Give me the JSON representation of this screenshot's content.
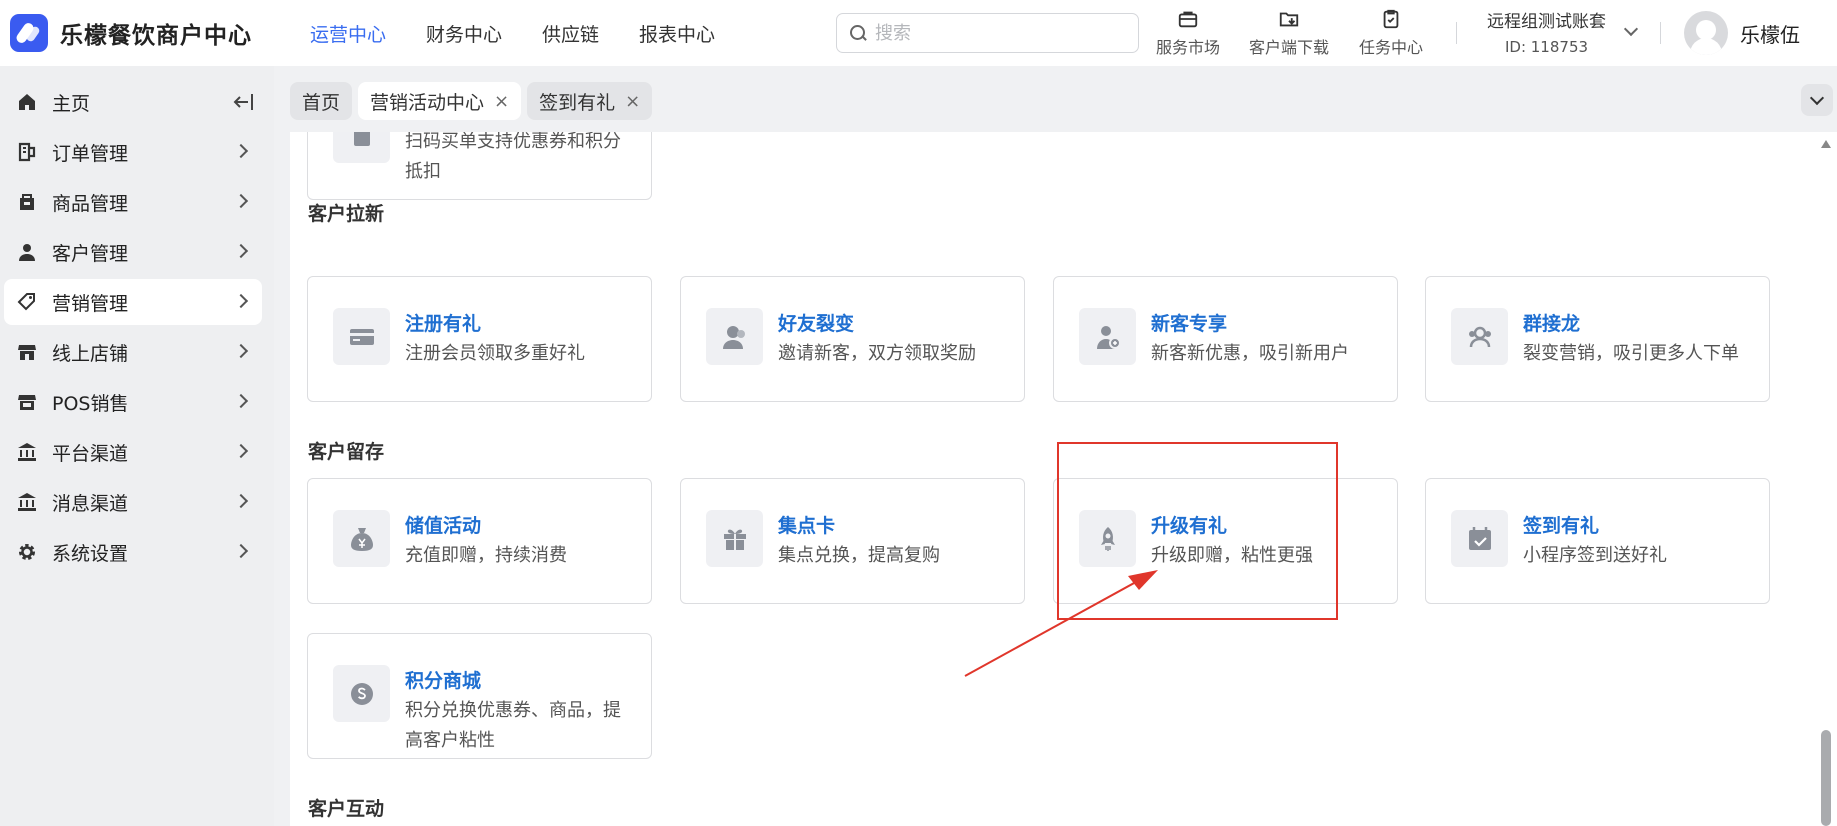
{
  "brand": {
    "name": "乐檬餐饮商户中心",
    "color": "#3a5bf0"
  },
  "topnav": [
    {
      "label": "运营中心",
      "active": true
    },
    {
      "label": "财务中心",
      "active": false
    },
    {
      "label": "供应链",
      "active": false
    },
    {
      "label": "报表中心",
      "active": false
    }
  ],
  "search": {
    "placeholder": "搜索",
    "value": ""
  },
  "tools": [
    {
      "label": "服务市场",
      "icon": "briefcase-icon"
    },
    {
      "label": "客户端下载",
      "icon": "folder-download-icon"
    },
    {
      "label": "任务中心",
      "icon": "clipboard-icon"
    }
  ],
  "account": {
    "name": "远程组测试账套",
    "id_text": "ID: 118753"
  },
  "user": {
    "name": "乐檬伍"
  },
  "sidebar": {
    "items": [
      {
        "label": "主页",
        "icon": "home-icon"
      },
      {
        "label": "订单管理",
        "icon": "order-icon"
      },
      {
        "label": "商品管理",
        "icon": "goods-icon"
      },
      {
        "label": "客户管理",
        "icon": "user-icon"
      },
      {
        "label": "营销管理",
        "icon": "tag-icon",
        "active": true
      },
      {
        "label": "线上店铺",
        "icon": "store-icon"
      },
      {
        "label": "POS销售",
        "icon": "pos-icon"
      },
      {
        "label": "平台渠道",
        "icon": "bank-icon"
      },
      {
        "label": "消息渠道",
        "icon": "bank-icon"
      },
      {
        "label": "系统设置",
        "icon": "gear-icon"
      }
    ]
  },
  "tabs": [
    {
      "label": "首页",
      "closable": false,
      "active": false
    },
    {
      "label": "营销活动中心",
      "closable": true,
      "active": true
    },
    {
      "label": "签到有礼",
      "closable": true,
      "active": false
    }
  ],
  "close_glyph": "×",
  "content": {
    "partial_card": {
      "desc": "扫码买单支持优惠券和积分抵扣"
    },
    "sections": [
      {
        "title": "客户拉新"
      },
      {
        "title": "客户留存"
      },
      {
        "title": "客户互动"
      }
    ],
    "cards": [
      {
        "title": "注册有礼",
        "desc": "注册会员领取多重好礼",
        "icon": "card-icon"
      },
      {
        "title": "好友裂变",
        "desc": "邀请新客，双方领取奖励",
        "icon": "friends-icon"
      },
      {
        "title": "新客专享",
        "desc": "新客新优惠，吸引新用户",
        "icon": "new-user-icon"
      },
      {
        "title": "群接龙",
        "desc": "裂变营销，吸引更多人下单",
        "icon": "group-icon"
      },
      {
        "title": "储值活动",
        "desc": "充值即赠，持续消费",
        "icon": "money-bag-icon"
      },
      {
        "title": "集点卡",
        "desc": "集点兑换，提高复购",
        "icon": "gift-icon"
      },
      {
        "title": "升级有礼",
        "desc": "升级即赠，粘性更强",
        "icon": "rocket-icon",
        "highlighted": true
      },
      {
        "title": "签到有礼",
        "desc": "小程序签到送好礼",
        "icon": "calendar-check-icon"
      },
      {
        "title": "积分商城",
        "desc": "积分兑换优惠券、商品，提高客户粘性",
        "icon": "coin-icon"
      }
    ]
  },
  "colors": {
    "accent": "#3a6df0",
    "card_title": "#1f6fd1",
    "annotation": "#e0362b"
  }
}
